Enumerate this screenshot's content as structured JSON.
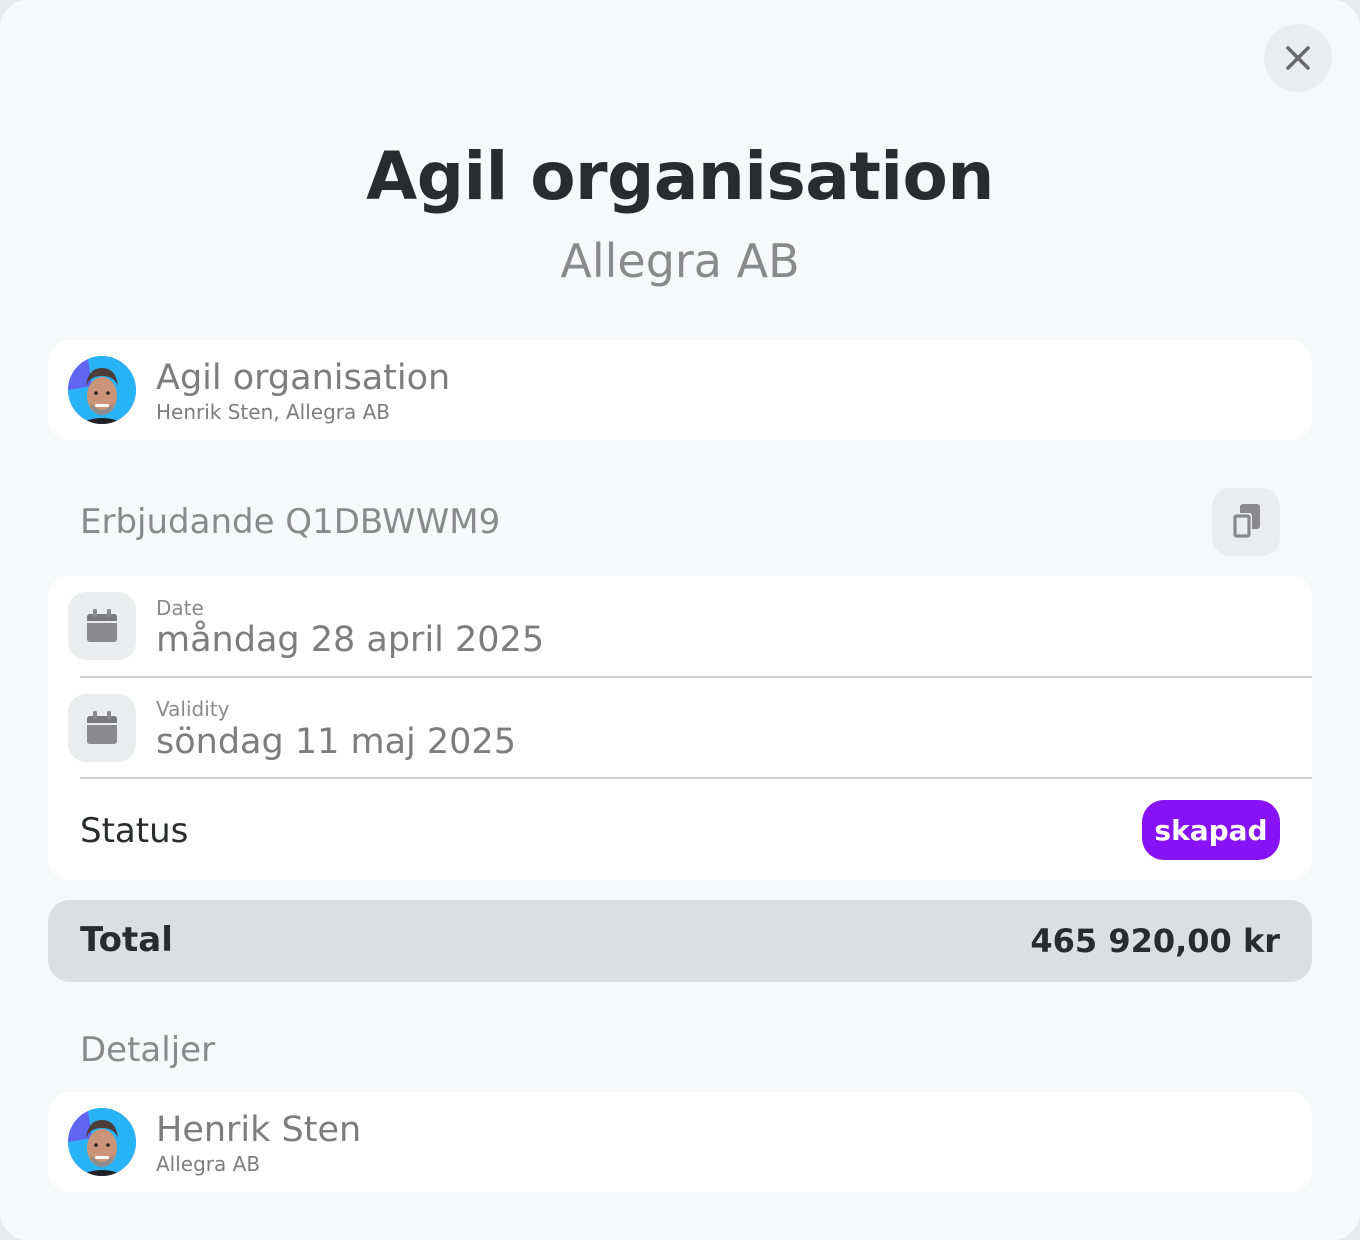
{
  "modal": {
    "title": "Agil organisation",
    "subtitle": "Allegra AB"
  },
  "header_card": {
    "title": "Agil organisation",
    "subtitle": "Henrik Sten, Allegra AB"
  },
  "offer": {
    "label": "Erbjudande Q1DBWWM9"
  },
  "info": {
    "date_label": "Date",
    "date_value": "måndag 28 april 2025",
    "validity_label": "Validity",
    "validity_value": "söndag 11 maj 2025",
    "status_label": "Status",
    "status_value": "skapad"
  },
  "total": {
    "label": "Total",
    "value": "465 920,00 kr"
  },
  "details": {
    "label": "Detaljer",
    "name": "Henrik Sten",
    "company": "Allegra AB"
  },
  "colors": {
    "status_badge": "#8612f5",
    "background": "#f7f8fa",
    "card": "#ffffff",
    "total_bar": "#dddee0"
  },
  "icons": [
    "close-icon",
    "copy-icon",
    "calendar-icon",
    "avatar"
  ]
}
